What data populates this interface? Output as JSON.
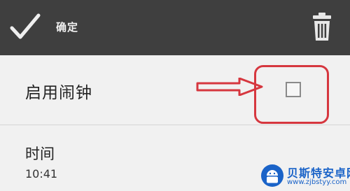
{
  "toolbar": {
    "confirm_label": "确定",
    "confirm_icon": "checkmark-icon",
    "delete_icon": "trash-icon",
    "background": "#3f3f3f"
  },
  "settings": {
    "alarm": {
      "label": "启用闹钟",
      "checked": false
    },
    "time": {
      "label": "时间",
      "value": "10:41"
    }
  },
  "annotation": {
    "color": "#d6373f"
  },
  "watermark": {
    "title": "贝斯特安卓网",
    "url": "www.zjbstyy.com",
    "accent": "#1a63c8"
  }
}
